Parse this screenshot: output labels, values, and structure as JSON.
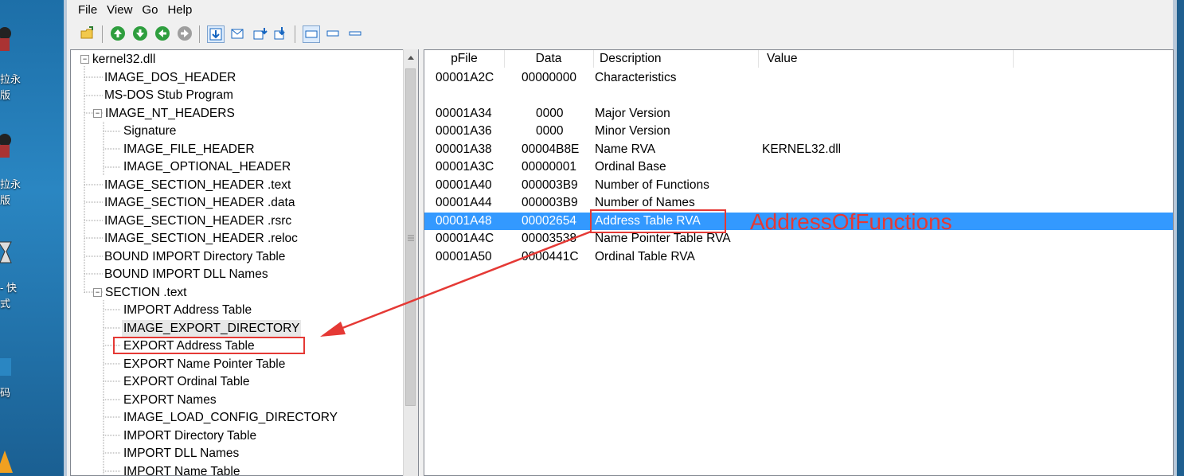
{
  "desktop": {
    "icons": [
      {
        "label": "拉永\n版"
      },
      {
        "label": "拉永\n版"
      },
      {
        "label": "- 快\n式"
      },
      {
        "label": "码"
      }
    ]
  },
  "menu": [
    "File",
    "View",
    "Go",
    "Help"
  ],
  "toolbar": {
    "buttons": [
      "open-icon",
      "go-up-icon",
      "go-down-icon",
      "go-back-icon",
      "go-forward-icon",
      "save-icon",
      "mail-icon",
      "import-icon",
      "export-icon",
      "view-large-icon",
      "view-medium-icon",
      "view-small-icon"
    ]
  },
  "tree": {
    "root": "kernel32.dll",
    "items": [
      "IMAGE_DOS_HEADER",
      "MS-DOS Stub Program",
      "IMAGE_NT_HEADERS",
      "Signature",
      "IMAGE_FILE_HEADER",
      "IMAGE_OPTIONAL_HEADER",
      "IMAGE_SECTION_HEADER .text",
      "IMAGE_SECTION_HEADER .data",
      "IMAGE_SECTION_HEADER .rsrc",
      "IMAGE_SECTION_HEADER .reloc",
      "BOUND IMPORT Directory Table",
      "BOUND IMPORT DLL Names",
      "SECTION .text",
      "IMPORT Address Table",
      "IMAGE_EXPORT_DIRECTORY",
      "EXPORT Address Table",
      "EXPORT Name Pointer Table",
      "EXPORT Ordinal Table",
      "EXPORT Names",
      "IMAGE_LOAD_CONFIG_DIRECTORY",
      "IMPORT Directory Table",
      "IMPORT DLL Names",
      "IMPORT Name Table"
    ]
  },
  "list": {
    "columns": [
      "pFile",
      "Data",
      "Description",
      "Value"
    ],
    "rows": [
      {
        "pfile": "00001A2C",
        "data": "00000000",
        "desc": "Characteristics",
        "value": ""
      },
      {
        "pfile": "",
        "data": "",
        "desc": "",
        "value": ""
      },
      {
        "pfile": "00001A34",
        "data": "0000",
        "desc": "Major Version",
        "value": ""
      },
      {
        "pfile": "00001A36",
        "data": "0000",
        "desc": "Minor Version",
        "value": ""
      },
      {
        "pfile": "00001A38",
        "data": "00004B8E",
        "desc": "Name RVA",
        "value": "KERNEL32.dll"
      },
      {
        "pfile": "00001A3C",
        "data": "00000001",
        "desc": "Ordinal Base",
        "value": ""
      },
      {
        "pfile": "00001A40",
        "data": "000003B9",
        "desc": "Number of Functions",
        "value": ""
      },
      {
        "pfile": "00001A44",
        "data": "000003B9",
        "desc": "Number of Names",
        "value": ""
      },
      {
        "pfile": "00001A48",
        "data": "00002654",
        "desc": "Address Table RVA",
        "value": ""
      },
      {
        "pfile": "00001A4C",
        "data": "00003538",
        "desc": "Name Pointer Table RVA",
        "value": ""
      },
      {
        "pfile": "00001A50",
        "data": "0000441C",
        "desc": "Ordinal Table RVA",
        "value": ""
      }
    ],
    "selected_index": 8
  },
  "annotation": {
    "text": "AddressOfFunctions",
    "color": "#e53935"
  },
  "colors": {
    "selection": "#3399ff"
  }
}
